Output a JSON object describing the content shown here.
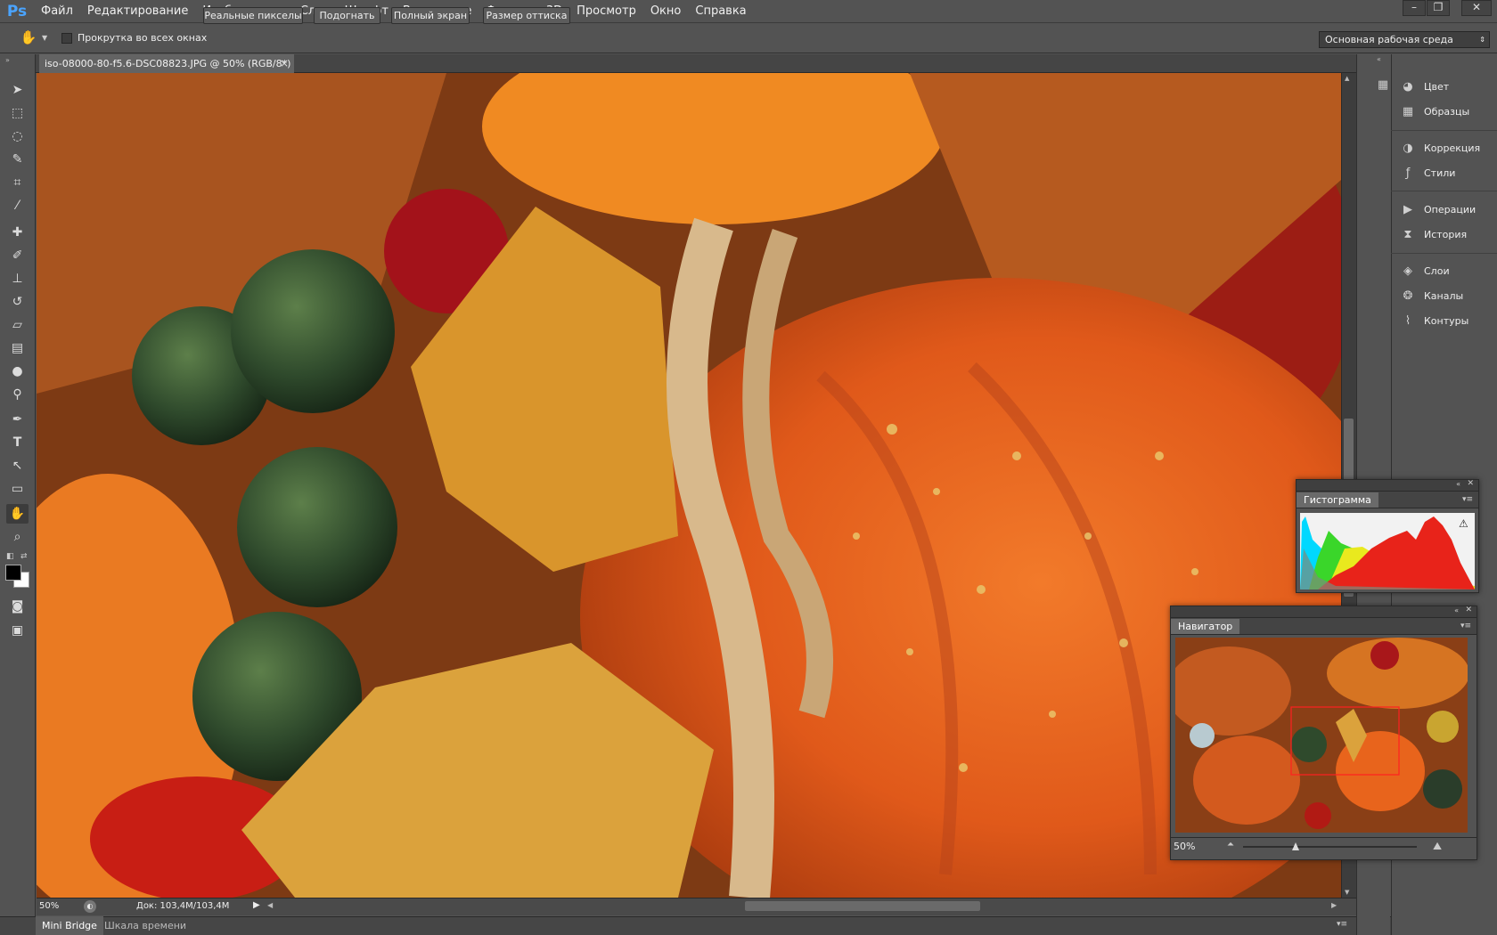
{
  "app": {
    "logo": "Ps"
  },
  "menu": [
    "Файл",
    "Редактирование",
    "Изображение",
    "Слои",
    "Шрифт",
    "Выделение",
    "Фильтр",
    "3D",
    "Просмотр",
    "Окно",
    "Справка"
  ],
  "window_controls": {
    "minimize": "–",
    "maximize": "❐",
    "close": "✕"
  },
  "options": {
    "scroll_all_label": "Прокрутка во всех окнах",
    "buttons": [
      "Реальные пикселы",
      "Подогнать",
      "Полный экран",
      "Размер оттиска"
    ],
    "workspace": "Основная рабочая среда"
  },
  "document": {
    "tab_title": "iso-08000-80-f5.6-DSC08823.JPG @ 50% (RGB/8*)",
    "close": "×"
  },
  "status": {
    "zoom": "50%",
    "doc_info": "Док: 103,4M/103,4M"
  },
  "bottom_tabs": [
    "Mini Bridge",
    "Шкала времени"
  ],
  "dock": [
    {
      "label": "Цвет",
      "icon": "color-icon"
    },
    {
      "label": "Образцы",
      "icon": "swatches-icon"
    },
    {
      "label": "Коррекция",
      "icon": "adjustments-icon"
    },
    {
      "label": "Стили",
      "icon": "styles-icon"
    },
    {
      "label": "Операции",
      "icon": "actions-icon"
    },
    {
      "label": "История",
      "icon": "history-icon"
    },
    {
      "label": "Слои",
      "icon": "layers-icon"
    },
    {
      "label": "Каналы",
      "icon": "channels-icon"
    },
    {
      "label": "Контуры",
      "icon": "paths-icon"
    }
  ],
  "histogram": {
    "title": "Гистограмма"
  },
  "navigator": {
    "title": "Навигатор",
    "zoom": "50%",
    "zoom_slider_fraction": 0.3
  },
  "colors": {
    "accent": "#4aa4ff",
    "panel": "#535353",
    "canvas_bg": "#8a4f1b"
  }
}
